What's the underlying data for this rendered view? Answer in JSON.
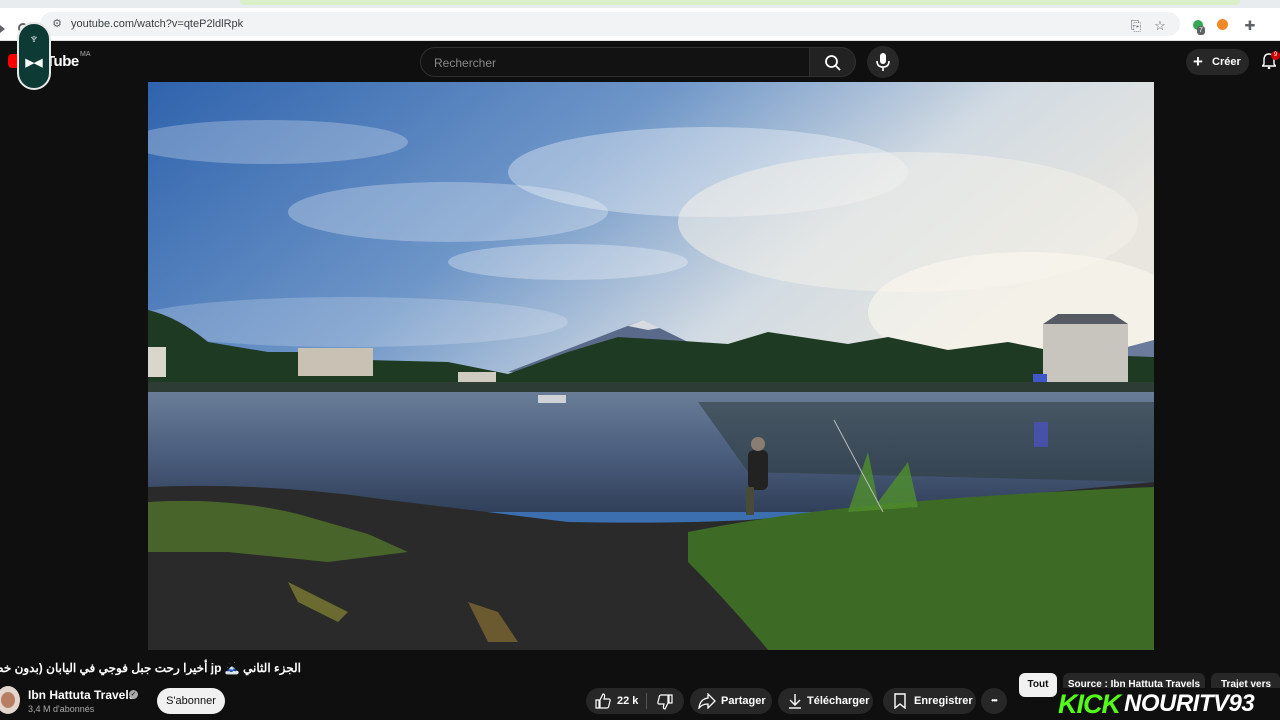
{
  "browser": {
    "url": "youtube.com/watch?v=qteP2ldlRpk",
    "extension_badge": "7"
  },
  "header": {
    "logo_text": "Tube",
    "country": "MA",
    "search_placeholder": "Rechercher",
    "create_label": "Créer",
    "notification_count": "9"
  },
  "video": {
    "title": "الجزء الثاني 🗻 jp أخيرا رحت جبل فوجي في اليابان (بدون خط"
  },
  "channel": {
    "name": "Ibn Hattuta Travels",
    "subscribers": "3,4 M d'abonnés",
    "subscribe_label": "S'abonner"
  },
  "actions": {
    "likes": "22 k",
    "share_label": "Partager",
    "download_label": "Télécharger",
    "save_label": "Enregistrer",
    "more": "•••"
  },
  "chips": [
    "Tout",
    "Source : Ibn Hattuta Travels",
    "Trajet vers"
  ],
  "overlay": {
    "kick_label": "KICK",
    "streamer": "NOURITV93"
  }
}
